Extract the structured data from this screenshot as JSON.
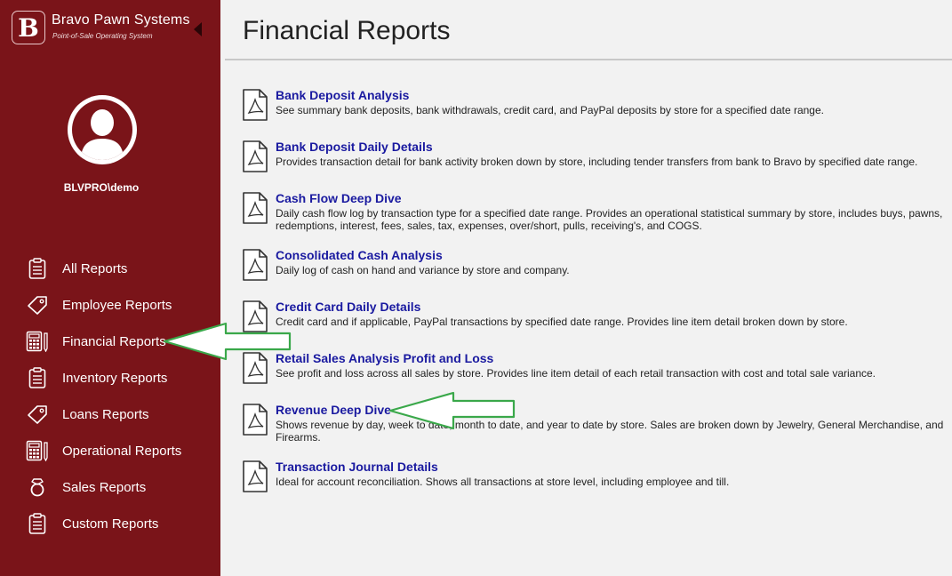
{
  "brand": {
    "logo_letter": "B",
    "name": "Bravo Pawn Systems",
    "tagline": "Point-of-Sale Operating System"
  },
  "user": {
    "name": "BLVPRO\\demo"
  },
  "nav": {
    "items": [
      {
        "label": "All Reports",
        "icon": "clipboard-icon"
      },
      {
        "label": "Employee Reports",
        "icon": "tag-icon"
      },
      {
        "label": "Financial Reports",
        "icon": "calculator-icon"
      },
      {
        "label": "Inventory Reports",
        "icon": "clipboard-icon"
      },
      {
        "label": "Loans Reports",
        "icon": "tag-icon"
      },
      {
        "label": "Operational Reports",
        "icon": "calculator-icon"
      },
      {
        "label": "Sales Reports",
        "icon": "ring-icon"
      },
      {
        "label": "Custom Reports",
        "icon": "clipboard-icon"
      }
    ]
  },
  "page": {
    "title": "Financial Reports"
  },
  "reports": [
    {
      "title": "Bank Deposit Analysis",
      "description": "See summary bank deposits, bank withdrawals, credit card, and PayPal deposits by store for a specified date range."
    },
    {
      "title": "Bank Deposit Daily Details",
      "description": "Provides transaction detail for bank activity broken down by store, including tender transfers from bank to Bravo by specified date range."
    },
    {
      "title": "Cash Flow Deep Dive",
      "description": "Daily cash flow log by transaction type for a specified date range. Provides an operational statistical summary by store, includes buys, pawns, redemptions, interest, fees, sales, tax, expenses, over/short, pulls, receiving's, and COGS."
    },
    {
      "title": "Consolidated Cash Analysis",
      "description": "Daily log of cash on hand and variance by store and company."
    },
    {
      "title": "Credit Card Daily Details",
      "description": "Credit card and if applicable, PayPal transactions by specified date range. Provides line item detail broken down by store."
    },
    {
      "title": "Retail Sales Analysis Profit and Loss",
      "description": "See profit and loss across all sales by store. Provides line item detail of each retail transaction with cost and total sale variance."
    },
    {
      "title": "Revenue Deep Dive",
      "description": "Shows revenue by day, week to date, month to date, and year to date by store. Sales are broken down by Jewelry, General Merchandise, and Firearms."
    },
    {
      "title": "Transaction Journal Details",
      "description": "Ideal for account reconciliation. Shows all transactions at store level, including employee and till."
    }
  ],
  "colors": {
    "sidebar": "#7a1419",
    "link": "#1a1aa0",
    "annotation_arrow": "#3aa84a"
  }
}
